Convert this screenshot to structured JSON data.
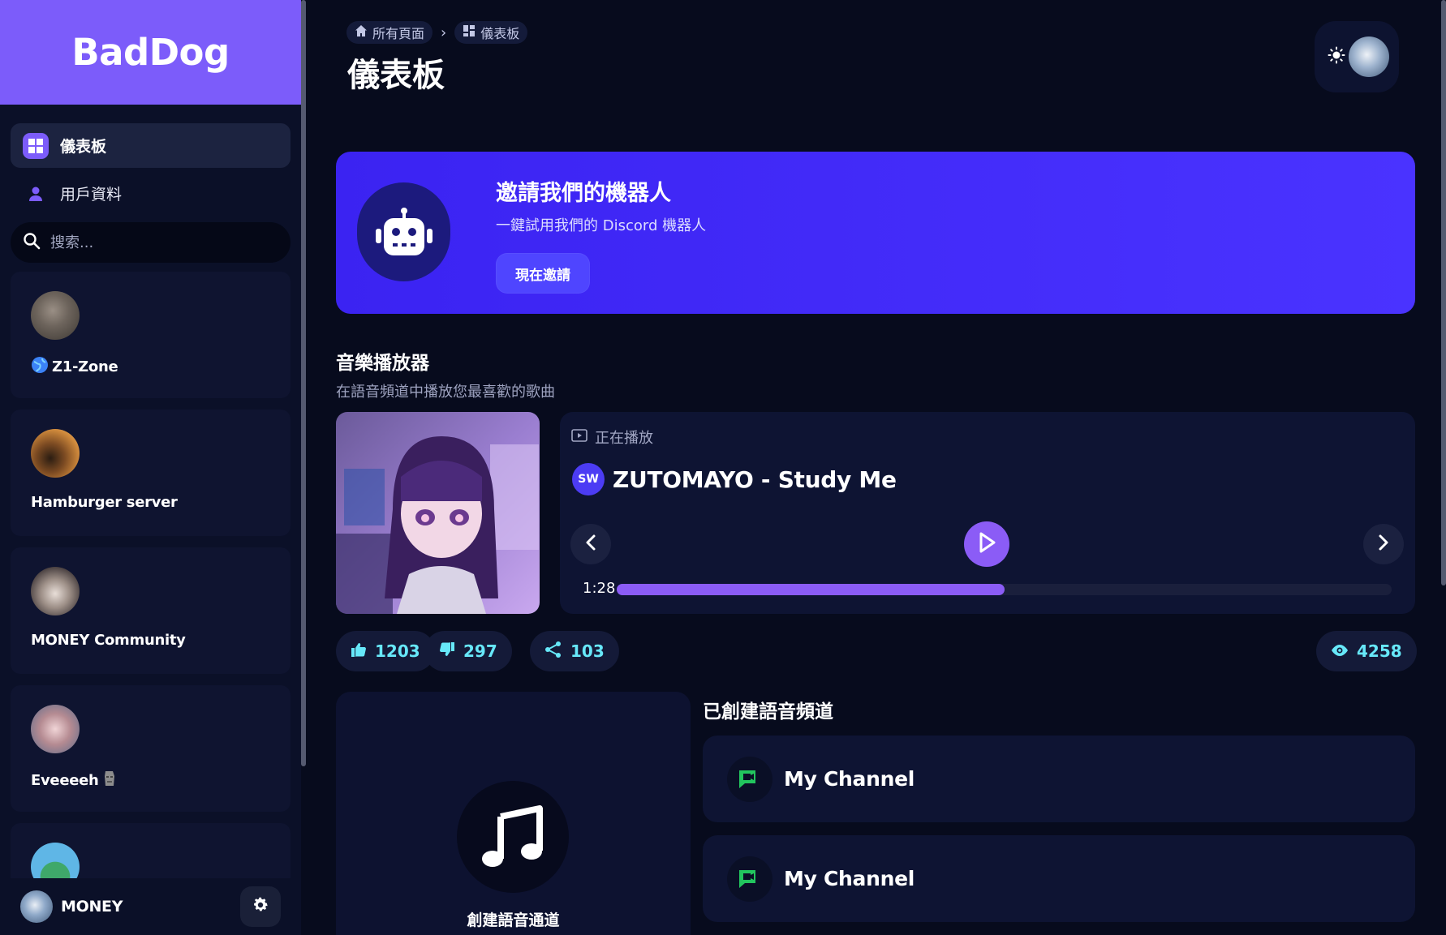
{
  "brand": "BadDog",
  "sidebar": {
    "nav": [
      {
        "label": "儀表板",
        "icon": "dashboard-icon",
        "active": true
      },
      {
        "label": "用戶資料",
        "icon": "user-icon",
        "active": false
      }
    ],
    "search_placeholder": "搜索...",
    "servers": [
      {
        "name": "Z1-Zone",
        "prefix_icon": "globe-icon"
      },
      {
        "name": "Hamburger server"
      },
      {
        "name": "MONEY Community"
      },
      {
        "name": "Eveeeeh",
        "suffix_icon": "moai-emoji-icon"
      },
      {
        "name": ""
      }
    ],
    "footer": {
      "username": "MONEY"
    }
  },
  "header": {
    "breadcrumb": [
      {
        "label": "所有頁面",
        "icon": "home-icon"
      },
      {
        "label": "儀表板",
        "icon": "dashboard-icon"
      }
    ],
    "title": "儀表板"
  },
  "invite": {
    "title": "邀請我們的機器人",
    "subtitle": "一鍵試用我們的 Discord 機器人",
    "button": "現在邀請"
  },
  "music": {
    "title": "音樂播放器",
    "subtitle": "在語音頻道中播放您最喜歡的歌曲",
    "now_playing_label": "正在播放",
    "badge": "SW",
    "song": "ZUTOMAYO - Study Me",
    "time": "1:28",
    "progress": 0.5,
    "likes": "1203",
    "dislikes": "297",
    "shares": "103",
    "views": "4258"
  },
  "voice": {
    "create_label": "創建語音通道",
    "created_title": "已創建語音頻道",
    "channels": [
      {
        "name": "My Channel"
      },
      {
        "name": "My Channel"
      }
    ]
  },
  "colors": {
    "accent": "#7c5cfa",
    "invite_bg": "#3b23f2",
    "stat_text": "#67e8f9",
    "channel_icon": "#22c55e"
  }
}
